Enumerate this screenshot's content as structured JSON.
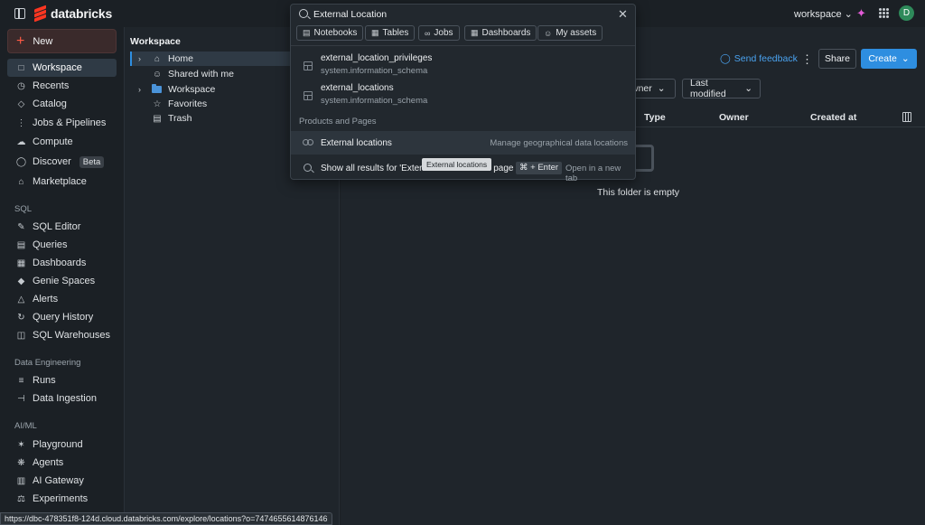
{
  "topbar": {
    "logo_text": "databricks",
    "workspace_label": "workspace",
    "avatar_initial": "D"
  },
  "sidenav": {
    "new_label": "New",
    "items": [
      {
        "label": "Workspace",
        "icon": "folder-icon",
        "active": true
      },
      {
        "label": "Recents",
        "icon": "clock-icon"
      },
      {
        "label": "Catalog",
        "icon": "catalog-icon"
      },
      {
        "label": "Jobs & Pipelines",
        "icon": "workflow-icon"
      },
      {
        "label": "Compute",
        "icon": "cloud-icon"
      },
      {
        "label": "Discover",
        "icon": "compass-icon",
        "badge": "Beta"
      },
      {
        "label": "Marketplace",
        "icon": "store-icon"
      }
    ],
    "sql_section": "SQL",
    "sql_items": [
      {
        "label": "SQL Editor",
        "icon": "editor-icon"
      },
      {
        "label": "Queries",
        "icon": "query-icon"
      },
      {
        "label": "Dashboards",
        "icon": "dashboard-icon"
      },
      {
        "label": "Genie Spaces",
        "icon": "genie-icon"
      },
      {
        "label": "Alerts",
        "icon": "bell-icon"
      },
      {
        "label": "Query History",
        "icon": "history-icon"
      },
      {
        "label": "SQL Warehouses",
        "icon": "warehouse-icon"
      }
    ],
    "de_section": "Data Engineering",
    "de_items": [
      {
        "label": "Runs",
        "icon": "runs-icon"
      },
      {
        "label": "Data Ingestion",
        "icon": "ingestion-icon"
      }
    ],
    "ai_section": "AI/ML",
    "ai_items": [
      {
        "label": "Playground",
        "icon": "playground-icon"
      },
      {
        "label": "Agents",
        "icon": "agents-icon"
      },
      {
        "label": "AI Gateway",
        "icon": "gateway-icon"
      },
      {
        "label": "Experiments",
        "icon": "experiments-icon"
      }
    ]
  },
  "browser": {
    "title": "Workspace",
    "tree": [
      {
        "label": "Home",
        "icon": "home-icon",
        "expandable": true,
        "selected": true
      },
      {
        "label": "Shared with me",
        "icon": "users-icon",
        "expandable": false
      },
      {
        "label": "Workspace",
        "icon": "folder-icon",
        "expandable": true
      },
      {
        "label": "Favorites",
        "icon": "star-icon",
        "expandable": false
      },
      {
        "label": "Trash",
        "icon": "trash-icon",
        "expandable": false
      }
    ]
  },
  "main": {
    "feedback_label": "Send feedback",
    "share_label": "Share",
    "create_label": "Create",
    "filter_owner": "wner",
    "filter_modified": "Last modified",
    "columns": [
      "Type",
      "Owner",
      "Created at"
    ],
    "empty_text": "This folder is empty"
  },
  "search": {
    "query": "External Location",
    "chips": [
      {
        "label": "Notebooks",
        "icon": "notebook-icon"
      },
      {
        "label": "Tables",
        "icon": "table-icon"
      },
      {
        "label": "Jobs",
        "icon": "jobs-icon"
      },
      {
        "label": "Dashboards",
        "icon": "dashboard-icon"
      },
      {
        "label": "My assets",
        "icon": "user-icon"
      }
    ],
    "results": [
      {
        "title": "external_location_privileges",
        "subtitle": "system.information_schema"
      },
      {
        "title": "external_locations",
        "subtitle": "system.information_schema"
      }
    ],
    "section_label": "Products and Pages",
    "page_result": {
      "title": "External locations",
      "description": "Manage geographical data locations"
    },
    "show_all_text": "Show all results for 'Externa",
    "show_all_page": "ll page",
    "shortcut": "⌘ + Enter",
    "open_new_tab": "Open in a new tab",
    "tooltip": "External locations"
  },
  "statusbar": {
    "url": "https://dbc-478351f8-124d.cloud.databricks.com/explore/locations?o=7474655614876146"
  },
  "colors": {
    "accent": "#2e8ee0",
    "brand": "#ff3621",
    "background": "#1b2025"
  }
}
